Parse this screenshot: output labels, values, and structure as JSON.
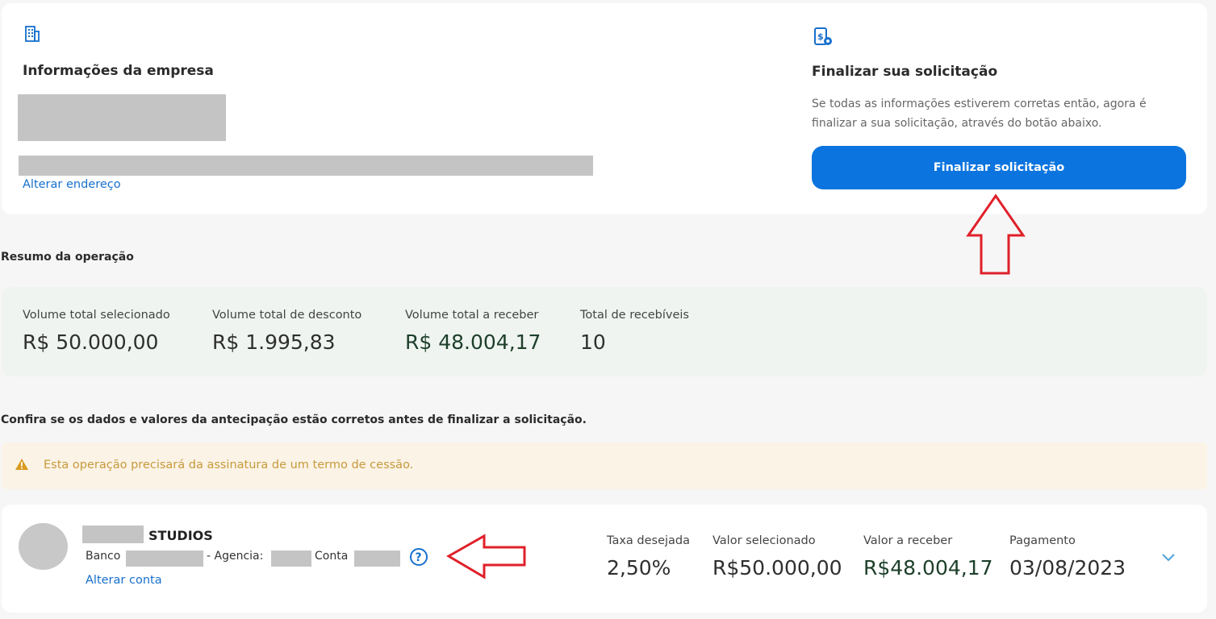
{
  "company": {
    "title": "Informações da empresa",
    "change_address": "Alterar endereço",
    "icon": "building-icon"
  },
  "finalize": {
    "title": "Finalizar sua solicitação",
    "description_line1": "Se todas as informações estiverem corretas então, agora é",
    "description_line2": "finalizar a sua solicitação, através do botão abaixo.",
    "button_label": "Finalizar solicitação",
    "icon": "document-money-icon"
  },
  "summary": {
    "title": "Resumo da operação",
    "stats": [
      {
        "label": "Volume total selecionado",
        "value": "R$ 50.000,00"
      },
      {
        "label": "Volume total de desconto",
        "value": "R$ 1.995,83"
      },
      {
        "label": "Volume total a receber",
        "value": "R$ 48.004,17"
      },
      {
        "label": "Total de recebíveis",
        "value": "10"
      }
    ]
  },
  "confirm_text": "Confira se os dados e valores da antecipação estão corretos antes de finalizar a solicitação.",
  "warning": {
    "text": "Esta operação precisará da assinatura de um termo de cessão.",
    "icon": "warning-triangle-icon"
  },
  "account": {
    "name_suffix": "STUDIOS",
    "bank_label": "Banco",
    "agency_label": "- Agencia:",
    "account_label": "Conta",
    "change_account": "Alterar conta",
    "columns": [
      {
        "label": "Taxa desejada",
        "value": "2,50%"
      },
      {
        "label": "Valor selecionado",
        "value": "R$50.000,00"
      },
      {
        "label": "Valor a receber",
        "value": "R$48.004,17"
      },
      {
        "label": "Pagamento",
        "value": "03/08/2023"
      }
    ]
  },
  "colors": {
    "primary": "#0b74de",
    "link": "#1670cc",
    "annotation": "#e0202a",
    "warning": "#c79a3c"
  }
}
